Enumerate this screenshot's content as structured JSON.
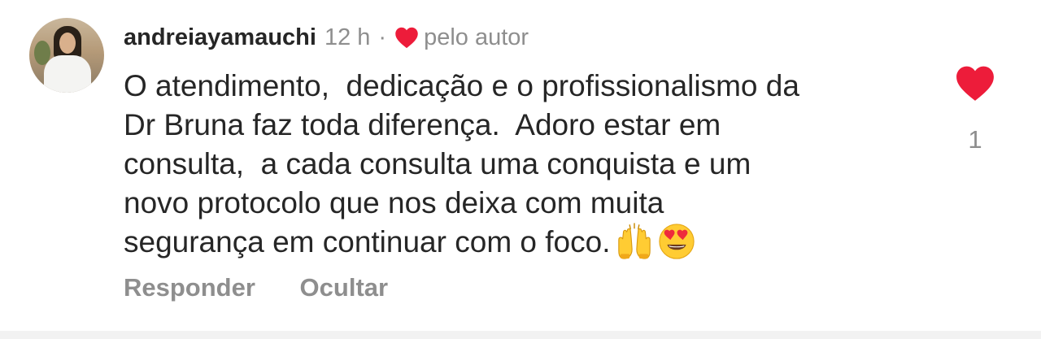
{
  "comment": {
    "username": "andreiayamauchi",
    "time": "12 h",
    "separator": "·",
    "liked_by_author_label": "pelo autor",
    "text_lines": [
      "O atendimento,  dedicação e o profissionalismo da",
      "Dr Bruna faz toda diferença.  Adoro estar em",
      "consulta,  a cada consulta uma conquista e um",
      "novo protocolo que nos deixa com muita",
      "segurança em continuar com o foco."
    ],
    "emojis": [
      "raising-hands-emoji",
      "heart-eyes-emoji"
    ],
    "like_count": "1",
    "actions": {
      "reply": "Responder",
      "hide": "Ocultar"
    }
  },
  "colors": {
    "heart": "#ed1c3a",
    "text": "#262626",
    "muted": "#8e8e8e"
  }
}
